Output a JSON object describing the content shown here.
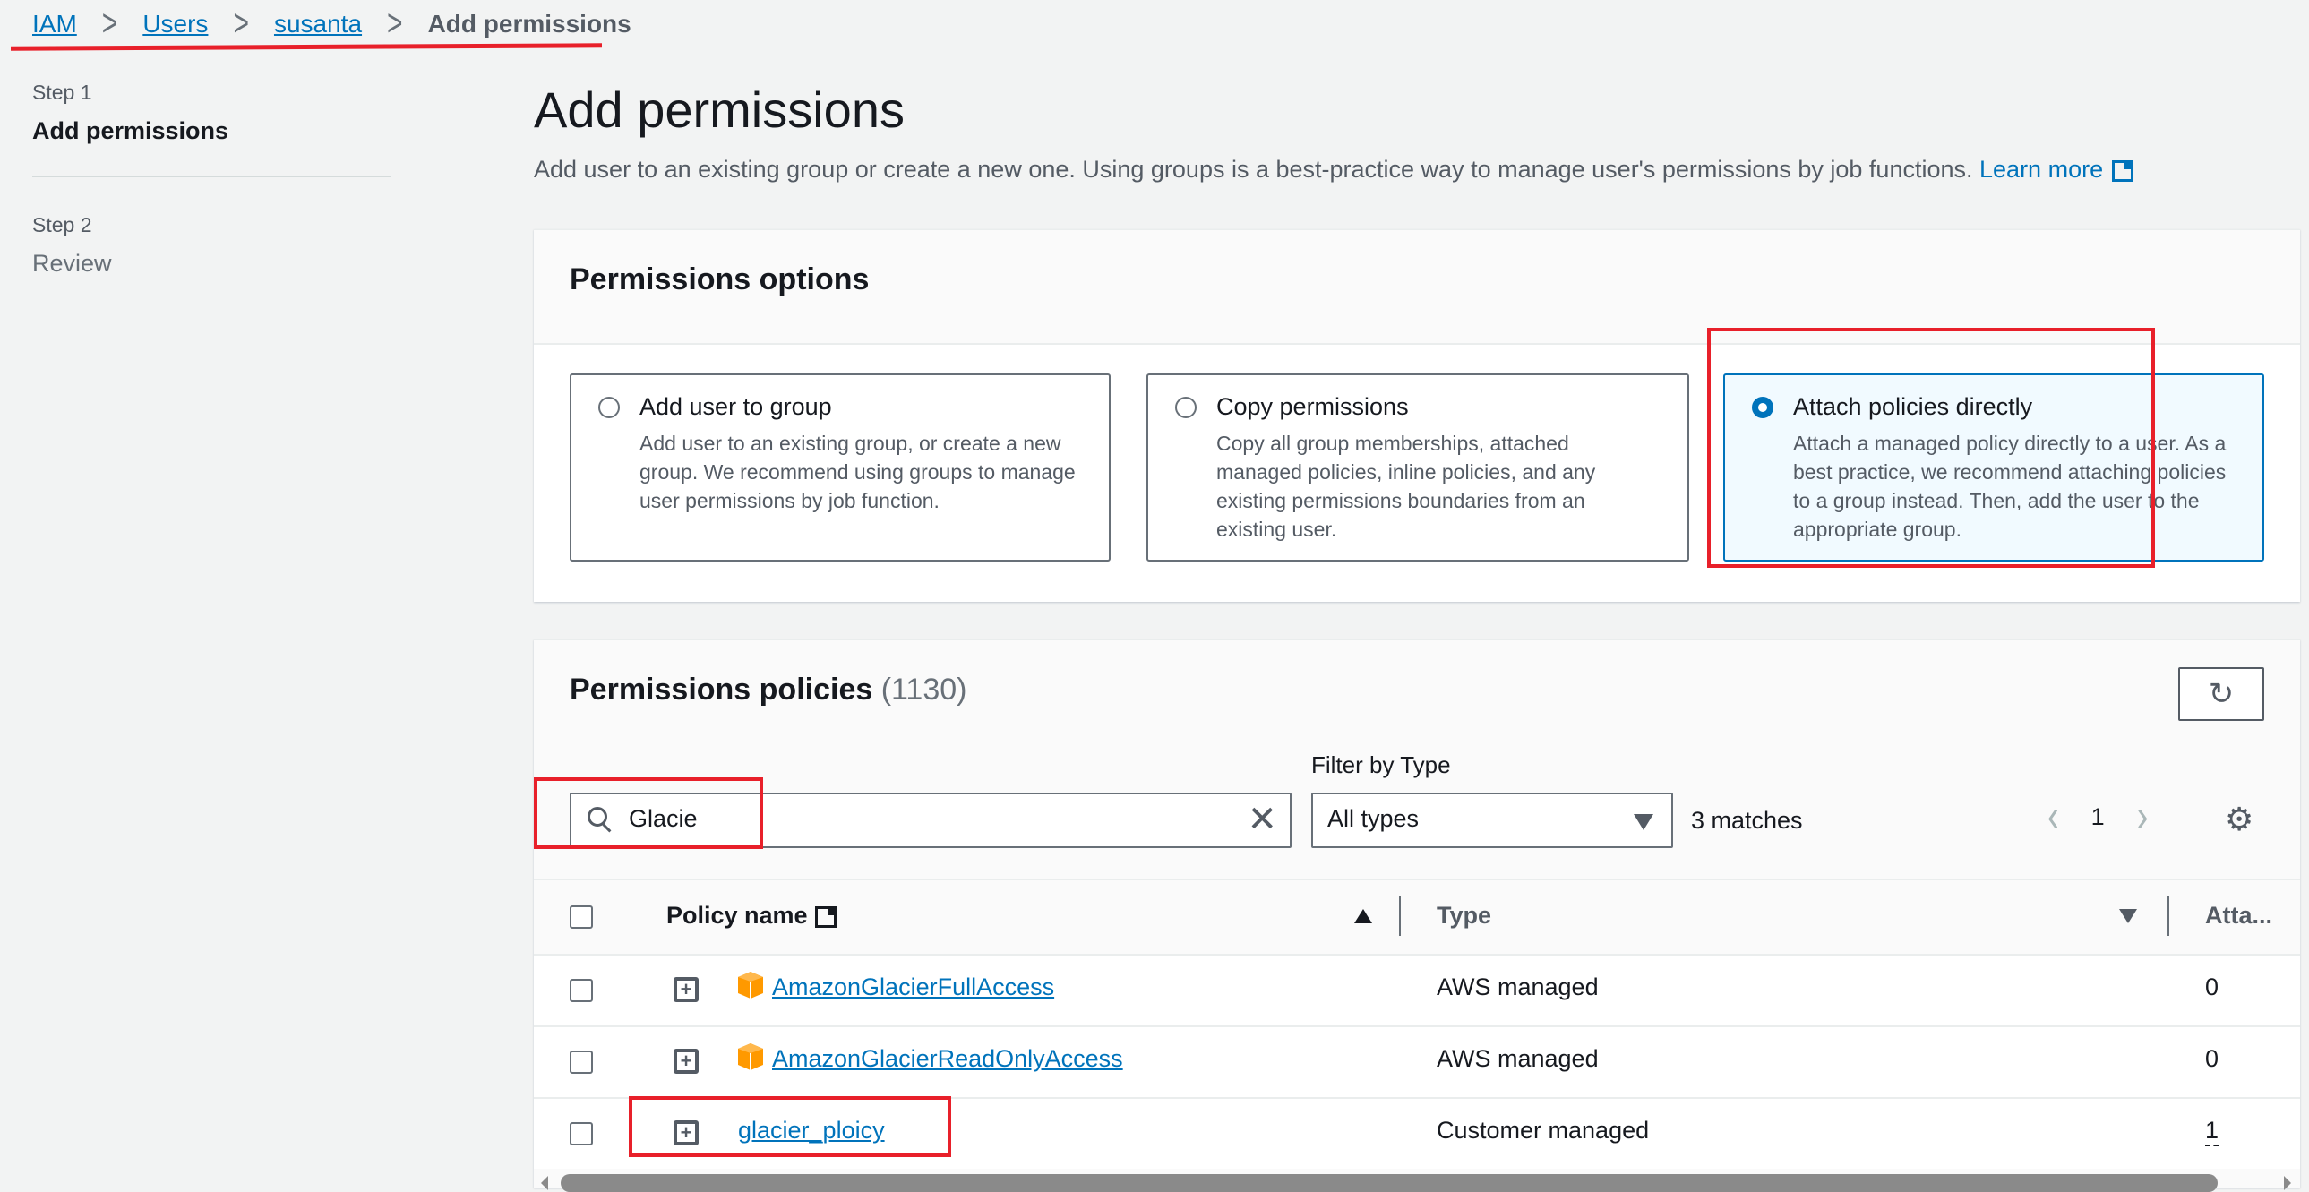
{
  "breadcrumb": {
    "items": [
      {
        "label": "IAM",
        "link": true
      },
      {
        "label": "Users",
        "link": true
      },
      {
        "label": "susanta",
        "link": true
      },
      {
        "label": "Add permissions",
        "link": false
      }
    ]
  },
  "steps": [
    {
      "number": "Step 1",
      "title": "Add permissions",
      "active": true
    },
    {
      "number": "Step 2",
      "title": "Review",
      "active": false
    }
  ],
  "page": {
    "title": "Add permissions",
    "description": "Add user to an existing group or create a new one. Using groups is a best-practice way to manage user's permissions by job functions.",
    "learn_more": "Learn more"
  },
  "permissions_options": {
    "title": "Permissions options",
    "options": [
      {
        "label": "Add user to group",
        "description": "Add user to an existing group, or create a new group. We recommend using groups to manage user permissions by job function.",
        "selected": false
      },
      {
        "label": "Copy permissions",
        "description": "Copy all group memberships, attached managed policies, inline policies, and any existing permissions boundaries from an existing user.",
        "selected": false
      },
      {
        "label": "Attach policies directly",
        "description": "Attach a managed policy directly to a user. As a best practice, we recommend attaching policies to a group instead. Then, add the user to the appropriate group.",
        "selected": true
      }
    ]
  },
  "policies": {
    "title": "Permissions policies",
    "count": "(1130)",
    "search": {
      "value": "Glacie",
      "icon": "search-icon",
      "clear_icon": "close-icon"
    },
    "filter": {
      "label": "Filter by Type",
      "selected": "All types"
    },
    "matches": "3 matches",
    "pagination": {
      "current_page": "1",
      "prev": "‹",
      "next": "›"
    },
    "settings_icon": "gear-icon",
    "refresh_icon": "refresh-icon",
    "columns": [
      "Policy name",
      "Type",
      "Atta..."
    ],
    "rows": [
      {
        "name": "AmazonGlacierFullAccess",
        "type": "AWS managed",
        "attached": "0",
        "aws_icon": true
      },
      {
        "name": "AmazonGlacierReadOnlyAccess",
        "type": "AWS managed",
        "attached": "0",
        "aws_icon": true
      },
      {
        "name": "glacier_ploicy",
        "type": "Customer managed",
        "attached": "1",
        "aws_icon": false
      }
    ]
  },
  "colors": {
    "link": "#0073bb",
    "annotation": "#e8202a",
    "aws_icon": "#ff9900",
    "selected_card_bg": "#f1faff"
  }
}
